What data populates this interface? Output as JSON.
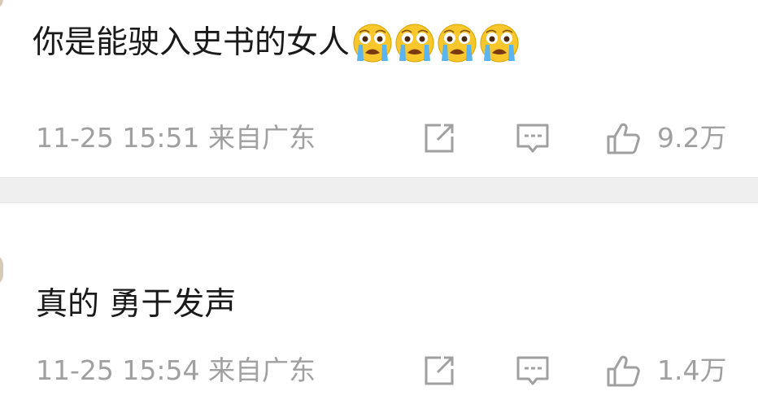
{
  "comments": [
    {
      "text": "你是能驶入史书的女人",
      "emojis": [
        "crying-face-icon",
        "crying-face-icon",
        "crying-face-icon",
        "crying-face-icon"
      ],
      "time": "11-25 15:51",
      "source": "来自广东",
      "likes": "9.2万"
    },
    {
      "text": "真的 勇于发声",
      "time": "11-25 15:54",
      "source": "来自广东",
      "likes": "1.4万"
    }
  ],
  "colors": {
    "text": "#1a1a1a",
    "meta": "#a0a0a0",
    "separator": "#efefef",
    "emoji_face": "#f7c72b"
  }
}
